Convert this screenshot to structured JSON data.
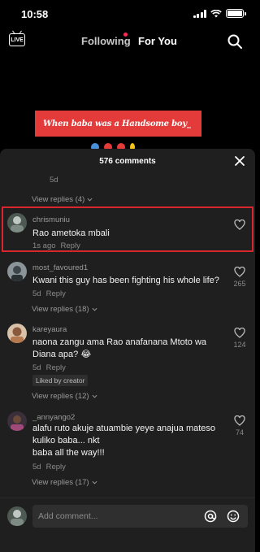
{
  "status": {
    "time": "10:58"
  },
  "nav": {
    "following": "Following",
    "for_you": "For You"
  },
  "video": {
    "caption": "When baba was a Handsome boy_"
  },
  "comments_panel": {
    "count_label": "576 comments",
    "top_partial": {
      "time": "5d",
      "view_replies": "View replies (4)"
    },
    "comments": [
      {
        "username": "chrismuniu",
        "text": "Rao ametoka mbali",
        "time": "1s ago",
        "reply": "Reply",
        "likes": ""
      },
      {
        "username": "most_favoured1",
        "text": "Kwani this guy has been fighting his whole life?",
        "time": "5d",
        "reply": "Reply",
        "likes": "265",
        "view_replies": "View replies (18)"
      },
      {
        "username": "kareyaura",
        "text": "naona zangu ama Rao anafanana Mtoto wa Diana apa? 😂",
        "time": "5d",
        "reply": "Reply",
        "likes": "124",
        "badge": "Liked by creator",
        "view_replies": "View replies (12)"
      },
      {
        "username": "_annyango2",
        "text": "alafu ruto akuje atuambie yeye anajua mateso kuliko baba... nkt",
        "text2": "baba all the way!!!",
        "time": "5d",
        "reply": "Reply",
        "likes": "74",
        "view_replies": "View replies (17)"
      }
    ]
  },
  "footer": {
    "placeholder": "Add comment..."
  },
  "colors": {
    "accent": "#fe2c55",
    "highlight": "#d8262f",
    "banner": "#e33a3a"
  }
}
